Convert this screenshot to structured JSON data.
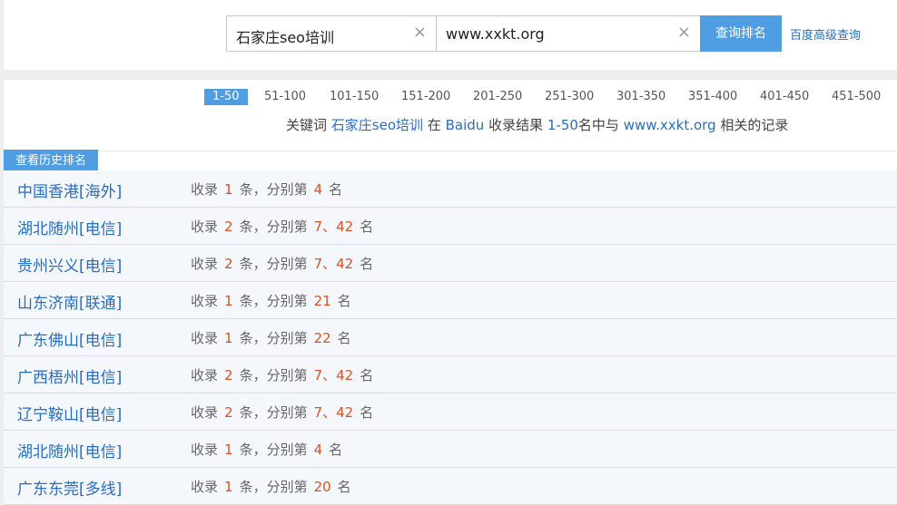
{
  "search": {
    "keyword_value": "石家庄seo培训",
    "site_value": "www.xxkt.org",
    "clear_glyph": "×",
    "button_label": "查询排名",
    "advanced_link": "百度高级查询"
  },
  "pager": {
    "pages": [
      "1-50",
      "51-100",
      "101-150",
      "151-200",
      "201-250",
      "251-300",
      "301-350",
      "351-400",
      "401-450",
      "451-500"
    ],
    "active_index": 0
  },
  "summary": {
    "prefix": "关键词",
    "keyword": "石家庄seo培训",
    "in": "在",
    "engine": "Baidu",
    "results_label": "收录结果",
    "range": "1-50",
    "middle": "名中与",
    "site": "www.xxkt.org",
    "suffix": "相关的记录"
  },
  "history_tab_label": "查看历史排名",
  "row_text": {
    "prefix": "收录",
    "middle": "条，分别第",
    "suffix": "名"
  },
  "rows": [
    {
      "location": "中国香港[海外]",
      "count": "1",
      "ranks": "4"
    },
    {
      "location": "湖北随州[电信]",
      "count": "2",
      "ranks": "7、42"
    },
    {
      "location": "贵州兴义[电信]",
      "count": "2",
      "ranks": "7、42"
    },
    {
      "location": "山东济南[联通]",
      "count": "1",
      "ranks": "21"
    },
    {
      "location": "广东佛山[电信]",
      "count": "1",
      "ranks": "22"
    },
    {
      "location": "广西梧州[电信]",
      "count": "2",
      "ranks": "7、42"
    },
    {
      "location": "辽宁鞍山[电信]",
      "count": "2",
      "ranks": "7、42"
    },
    {
      "location": "湖北随州[电信]",
      "count": "1",
      "ranks": "4"
    },
    {
      "location": "广东东莞[多线]",
      "count": "1",
      "ranks": "20"
    }
  ],
  "colors": {
    "accent": "#4f9ee3",
    "link": "#2a6dc0",
    "highlight": "#e0501e",
    "row_bg": "#f4f8fd"
  }
}
